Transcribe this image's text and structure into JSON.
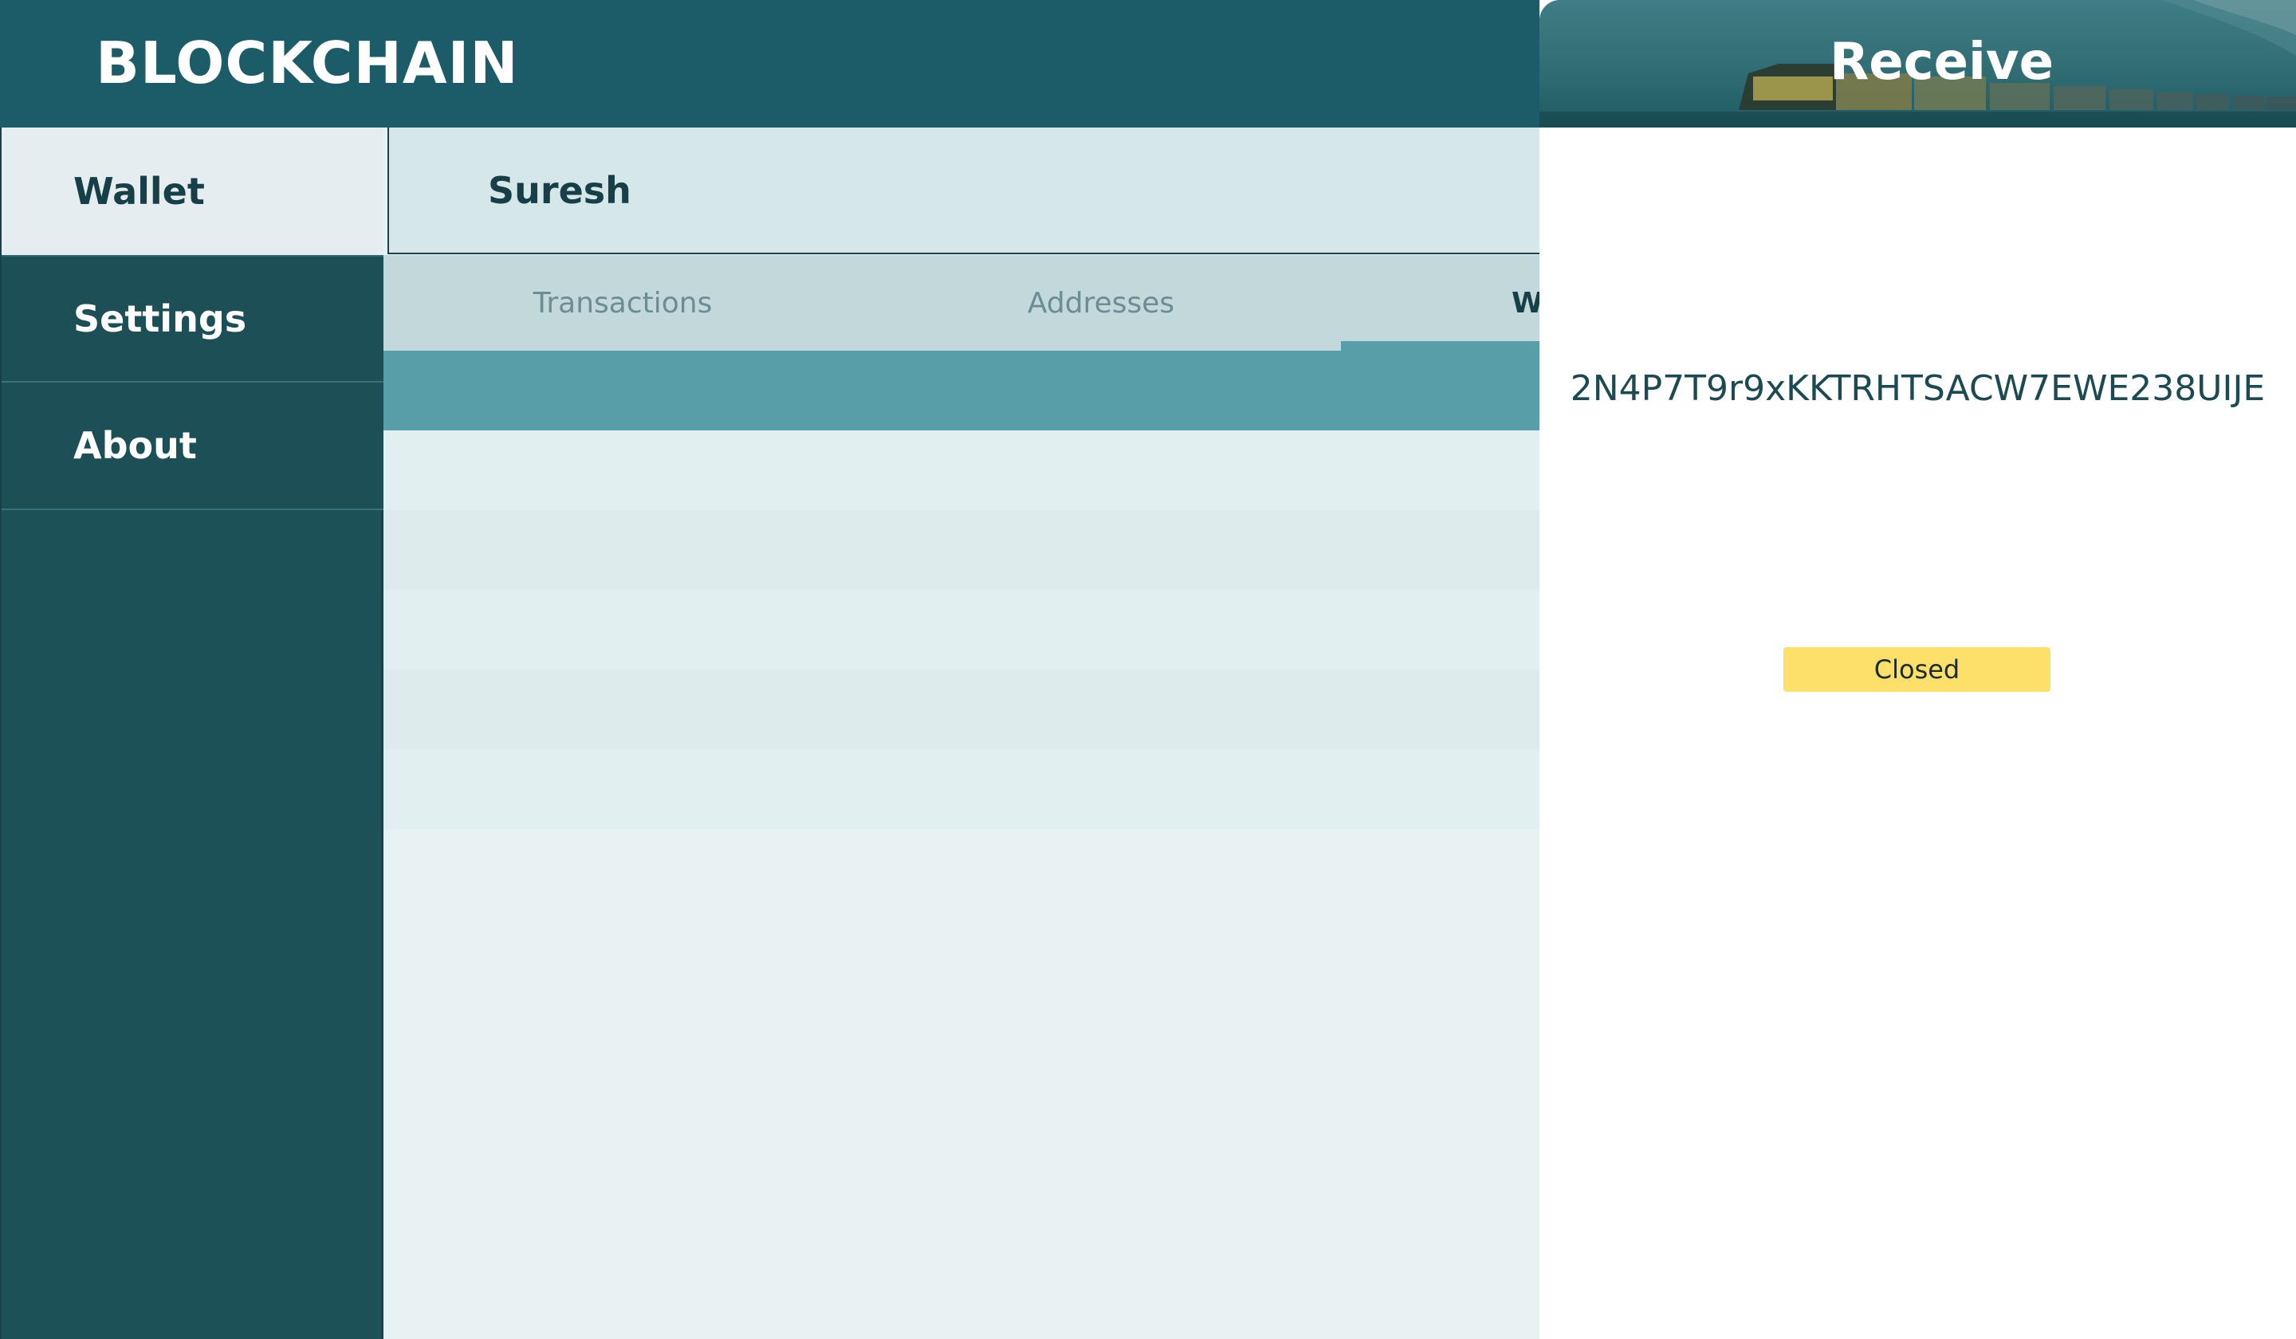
{
  "app": {
    "title": "BLOCKCHAIN"
  },
  "sidebar": {
    "items": [
      {
        "label": "Wallet",
        "active": true
      },
      {
        "label": "Settings",
        "active": false
      },
      {
        "label": "About",
        "active": false
      }
    ]
  },
  "wallet": {
    "user_name": "Suresh",
    "tabs": [
      {
        "label": "Transactions",
        "active": false
      },
      {
        "label": "Addresses",
        "active": false
      },
      {
        "label": "W",
        "active": true
      }
    ]
  },
  "receive_dialog": {
    "title": "Receive",
    "address": "2N4P7T9r9xKKTRHTSACW7EWE238UIJE",
    "close_button_label": "Closed"
  },
  "colors": {
    "header": "#1b5c68",
    "sidebar": "#1c5158",
    "accent": "#579ea9",
    "button_yellow": "#fde06a"
  }
}
